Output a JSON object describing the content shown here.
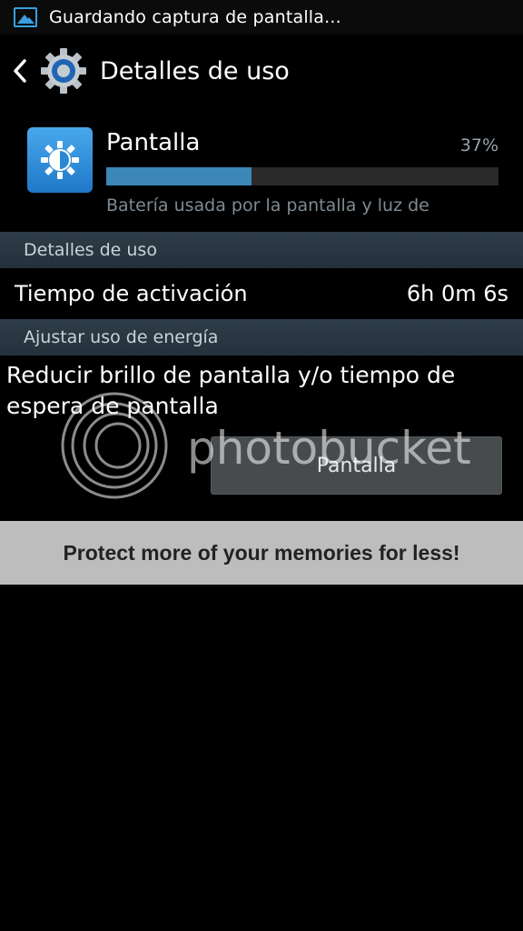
{
  "status_bar": {
    "icon": "screenshot-icon",
    "text": "Guardando captura de pantalla..."
  },
  "action_bar": {
    "back_icon": "back-arrow-icon",
    "app_icon": "settings-gear-icon",
    "title": "Detalles de uso"
  },
  "usage_item": {
    "icon": "display-brightness-icon",
    "name": "Pantalla",
    "percent_label": "37%",
    "percent_value": 0.37,
    "description": "Batería usada por la pantalla y luz de"
  },
  "sections": {
    "usage_details_header": "Detalles de uso",
    "adjust_power_header": "Ajustar uso de energía"
  },
  "active_time": {
    "label": "Tiempo de activación",
    "value": "6h 0m 6s"
  },
  "advice": {
    "text": "Reducir brillo de pantalla y/o tiempo de espera de pantalla",
    "button_label": "Pantalla"
  },
  "watermark": {
    "text": "photobucket"
  },
  "ad_banner": {
    "text": "Protect more of your memories for less!"
  },
  "colors": {
    "accent_blue": "#3c86b8",
    "section_header": "#2a3844",
    "ad_background": "#bdbdbd"
  }
}
